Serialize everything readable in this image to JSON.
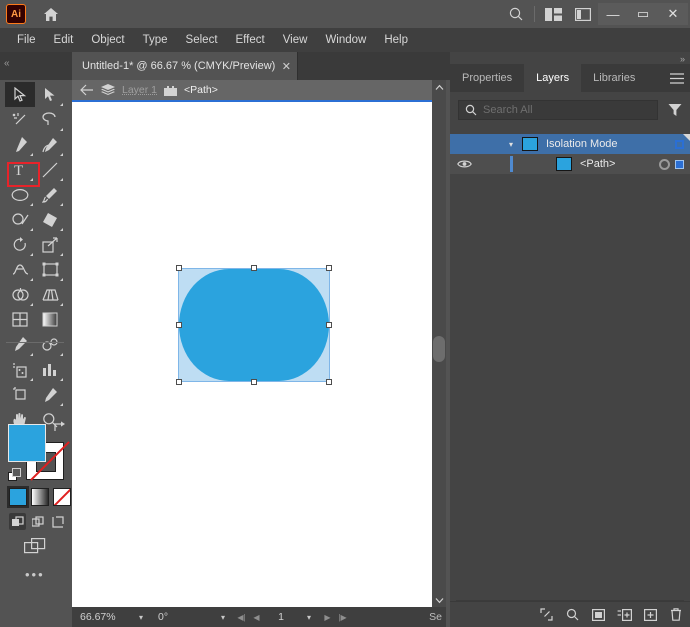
{
  "app": {
    "name": "Ai",
    "logo_label": "Ai"
  },
  "titlebar": {
    "home_icon": "home-icon",
    "search_icon": "search-icon",
    "arrange_documents_icon": "arrange-documents-icon",
    "workspace_switcher_icon": "workspace-switcher-icon",
    "minimize": "—",
    "maximize": "▭",
    "close": "✕"
  },
  "menubar": {
    "items": [
      {
        "label": "File"
      },
      {
        "label": "Edit"
      },
      {
        "label": "Object"
      },
      {
        "label": "Type"
      },
      {
        "label": "Select"
      },
      {
        "label": "Effect"
      },
      {
        "label": "View"
      },
      {
        "label": "Window"
      },
      {
        "label": "Help"
      }
    ]
  },
  "tabbar": {
    "collapse_left": "«",
    "collapse_right": "»",
    "document_tab": {
      "title": "Untitled-1* @ 66.67 % (CMYK/Preview)",
      "close": "✕"
    }
  },
  "breadcrumb": {
    "back_icon": "back-arrow-icon",
    "layers_icon": "layers-stack-icon",
    "layer_name": "Layer 1",
    "group_icon": "group-icon",
    "path_name": "<Path>",
    "collapse": "⌃"
  },
  "tools": {
    "highlight_color": "#e8232a",
    "items": [
      {
        "name": "selection-tool",
        "active": true
      },
      {
        "name": "direct-selection-tool",
        "active": false
      },
      {
        "name": "magic-wand-tool",
        "active": false
      },
      {
        "name": "lasso-tool",
        "active": false
      },
      {
        "name": "pen-tool",
        "active": false
      },
      {
        "name": "curvature-tool",
        "active": false
      },
      {
        "name": "type-tool",
        "active": false
      },
      {
        "name": "line-segment-tool",
        "active": false
      },
      {
        "name": "ellipse-tool",
        "active": false
      },
      {
        "name": "paintbrush-tool",
        "active": false
      },
      {
        "name": "shaper-tool",
        "active": false
      },
      {
        "name": "eraser-tool",
        "active": false
      },
      {
        "name": "rotate-tool",
        "active": false
      },
      {
        "name": "scale-tool",
        "active": false
      },
      {
        "name": "width-tool",
        "active": false
      },
      {
        "name": "free-transform-tool",
        "active": false
      },
      {
        "name": "shape-builder-tool",
        "active": false
      },
      {
        "name": "perspective-grid-tool",
        "active": false
      },
      {
        "name": "mesh-tool",
        "active": false
      },
      {
        "name": "gradient-tool",
        "active": false
      },
      {
        "name": "eyedropper-tool",
        "active": false
      },
      {
        "name": "blend-tool",
        "active": false
      },
      {
        "name": "symbol-sprayer-tool",
        "active": false
      },
      {
        "name": "column-graph-tool",
        "active": false
      },
      {
        "name": "artboard-tool",
        "active": false
      },
      {
        "name": "slice-tool",
        "active": false
      },
      {
        "name": "hand-tool",
        "active": false
      },
      {
        "name": "zoom-tool",
        "active": false
      }
    ],
    "fill_color": "#2ba3de",
    "stroke_color": "none",
    "swap_icon": "swap-fill-stroke-icon",
    "default_icon": "default-fill-stroke-icon",
    "color_modes": [
      {
        "name": "color-mode-color",
        "selected": true
      },
      {
        "name": "color-mode-gradient",
        "selected": false
      },
      {
        "name": "color-mode-none",
        "selected": false
      }
    ],
    "draw_modes": [
      {
        "name": "draw-normal-mode",
        "selected": true
      },
      {
        "name": "draw-behind-mode",
        "selected": false
      },
      {
        "name": "draw-inside-mode",
        "selected": false
      }
    ],
    "screen_mode_icon": "screen-mode-icon",
    "more_tools": "•••"
  },
  "canvas": {
    "background": "#ffffff",
    "shape": {
      "name": "rounded-blue-shape",
      "fill": "#2ba3de",
      "selected": true
    },
    "isolation_overlay": {
      "name": "isolation-mode-overlay",
      "tint": "rgba(150,200,235,0.62)"
    },
    "scroll": {
      "up_arrow": "▲",
      "down_arrow": "▼"
    }
  },
  "statusbar": {
    "zoom_level": "66.67%",
    "zoom_chevron": "▾",
    "rotation": "0°",
    "rotation_chevron": "▾",
    "first_page": "◀|",
    "prev_page": "◀",
    "page_number": "1",
    "page_chevron": "▾",
    "next_page": "▶",
    "last_page": "|▶",
    "tail_label": "Se"
  },
  "right_panel": {
    "collapse": "»",
    "tabs": [
      {
        "label": "Properties",
        "active": false
      },
      {
        "label": "Layers",
        "active": true
      },
      {
        "label": "Libraries",
        "active": false
      }
    ],
    "menu_icon": "panel-menu-icon",
    "search": {
      "placeholder": "Search All",
      "value": "",
      "icon": "search-icon",
      "filter_icon": "filter-funnel-icon"
    },
    "layers": [
      {
        "name": "Isolation Mode",
        "chevron": "▾",
        "thumb_color": "#2ba3de",
        "selected": true,
        "has_eye": false,
        "has_target": false
      },
      {
        "name": "<Path>",
        "chevron": "",
        "thumb_color": "#2ba3de",
        "selected": true,
        "has_eye": true,
        "has_target": true
      }
    ],
    "footer_icons": [
      {
        "name": "locate-object-icon"
      },
      {
        "name": "search-layer-icon"
      },
      {
        "name": "make-mask-icon"
      },
      {
        "name": "new-sublayer-icon"
      },
      {
        "name": "new-layer-icon"
      },
      {
        "name": "delete-layer-icon"
      }
    ]
  }
}
